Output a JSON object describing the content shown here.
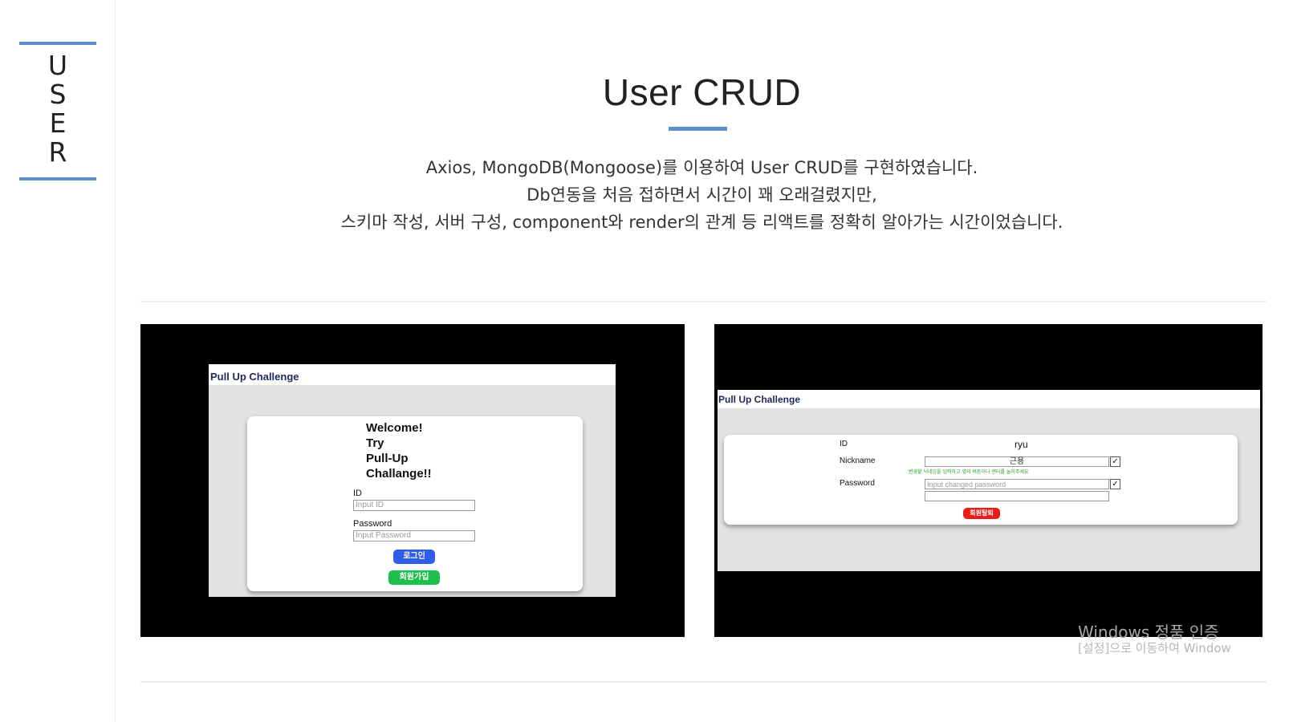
{
  "sidebar": {
    "letters": [
      "U",
      "S",
      "E",
      "R"
    ]
  },
  "header": {
    "title": "User CRUD",
    "description": [
      "Axios, MongoDB(Mongoose)를 이용하여 User CRUD를 구현하였습니다.",
      "Db연동을 처음 접하면서 시간이 꽤 오래걸렸지만,",
      "스키마 작성, 서버 구성, component와 render의 관계 등 리액트를 정확히 알아가는 시간이었습니다."
    ]
  },
  "login_screenshot": {
    "app_title": "Pull Up Challenge",
    "welcome_lines": [
      "Welcome!",
      "Try",
      "Pull-Up",
      "Challange!!"
    ],
    "id_label": "ID",
    "id_placeholder": "Input ID",
    "password_label": "Password",
    "password_placeholder": "Input Password",
    "login_button": "로그인",
    "signup_button": "회원가입"
  },
  "profile_screenshot": {
    "app_title": "Pull Up Challenge",
    "id_label": "ID",
    "id_value": "ryu",
    "nickname_label": "Nickname",
    "nickname_value": "근용",
    "nickname_hint": "변경할 닉네임을 입력하고 옆의 버튼이나 엔터를 눌러주세요",
    "password_label": "Password",
    "password_placeholder": "Input changed password",
    "withdraw_button": "회원탈퇴",
    "check_mark": "✓"
  },
  "os_watermark": {
    "line1": "Windows 정품 인증",
    "line2": "[설정]으로 이동하여 Window"
  },
  "colors": {
    "accent": "#5b8fd0",
    "login_button": "#2f5ce8",
    "signup_button": "#1fbf4e",
    "withdraw_button": "#ee1a1a"
  }
}
